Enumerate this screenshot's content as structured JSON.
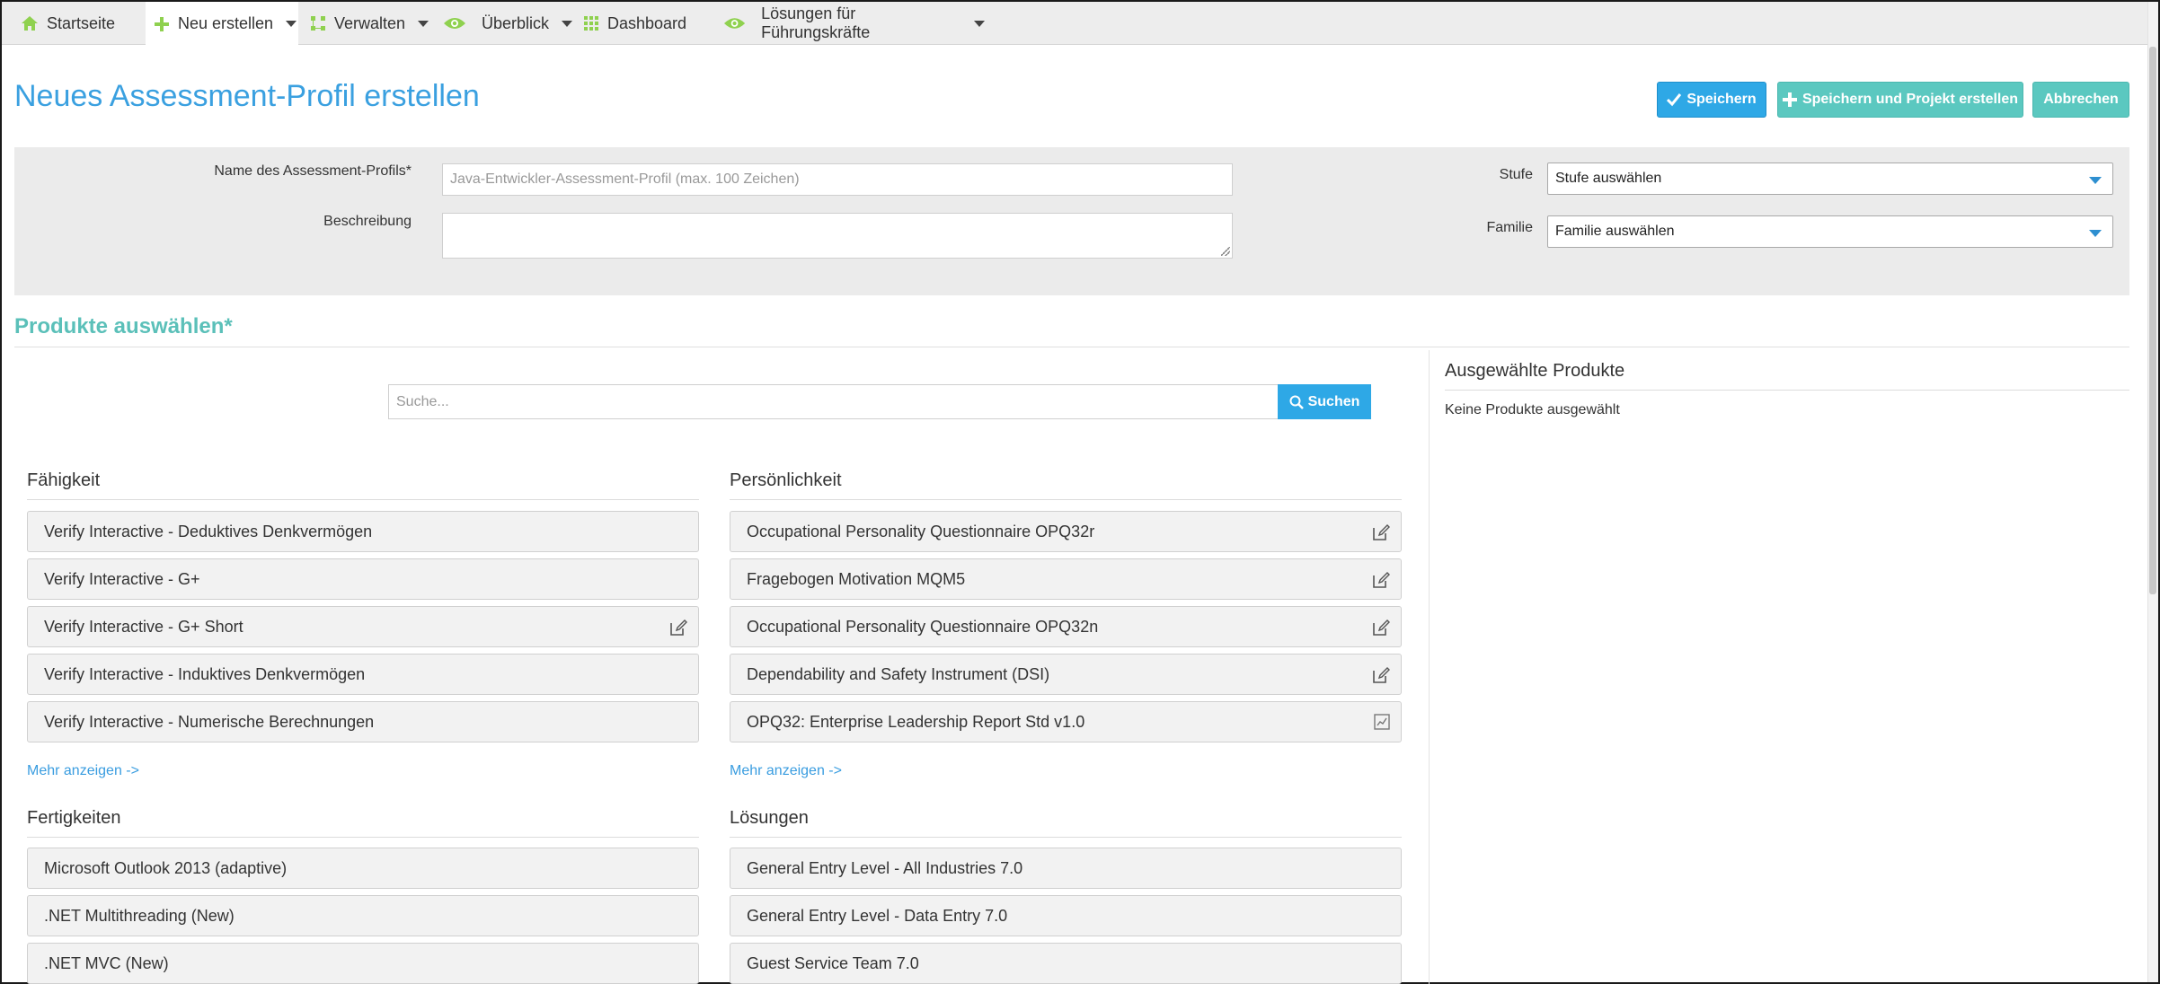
{
  "nav": {
    "items": [
      {
        "label": "Startseite",
        "icon": "home-icon",
        "color": "#8fd14f"
      },
      {
        "label": "Neu erstellen",
        "icon": "plus-icon",
        "color": "#8fd14f"
      },
      {
        "label": "Verwalten",
        "icon": "manage-icon",
        "color": "#8fd14f"
      },
      {
        "label": "Überblick",
        "icon": "eye-icon",
        "color": "#8fd14f"
      },
      {
        "label": "Dashboard",
        "icon": "grid-icon",
        "color": "#8fd14f"
      },
      {
        "label": "Lösungen für Führungskräfte",
        "icon": "eye-icon",
        "color": "#8fd14f"
      }
    ]
  },
  "page": {
    "title": "Neues Assessment-Profil erstellen"
  },
  "actions": {
    "save": "Speichern",
    "save_create_project": "Speichern und Projekt erstellen",
    "cancel": "Abbrechen"
  },
  "form": {
    "name_label": "Name des Assessment-Profils*",
    "name_placeholder": "Java-Entwickler-Assessment-Profil (max. 100 Zeichen)",
    "description_label": "Beschreibung",
    "level_label": "Stufe",
    "level_value": "Stufe auswählen",
    "family_label": "Familie",
    "family_value": "Familie auswählen"
  },
  "products": {
    "section_title": "Produkte auswählen*",
    "search_placeholder": "Suche...",
    "search_button": "Suchen",
    "more_link": "Mehr anzeigen ->",
    "categories": {
      "ability": {
        "title": "Fähigkeit",
        "items": [
          "Verify Interactive - Deduktives Denkvermögen",
          "Verify Interactive - G+",
          "Verify Interactive - G+ Short",
          "Verify Interactive - Induktives Denkvermögen",
          "Verify Interactive - Numerische Berechnungen"
        ]
      },
      "personality": {
        "title": "Persönlichkeit",
        "items": [
          "Occupational Personality Questionnaire OPQ32r",
          "Fragebogen Motivation MQM5",
          "Occupational Personality Questionnaire OPQ32n",
          "Dependability and Safety Instrument (DSI)",
          "OPQ32: Enterprise Leadership Report Std v1.0"
        ]
      },
      "skills": {
        "title": "Fertigkeiten",
        "items": [
          "Microsoft Outlook 2013 (adaptive)",
          ".NET Multithreading (New)",
          ".NET MVC (New)"
        ]
      },
      "solutions": {
        "title": "Lösungen",
        "items": [
          "General Entry Level - All Industries 7.0",
          "General Entry Level - Data Entry 7.0",
          "Guest Service Team 7.0"
        ]
      }
    }
  },
  "selected": {
    "title": "Ausgewählte Produkte",
    "empty_text": "Keine Produkte ausgewählt"
  },
  "colors": {
    "accent_blue": "#2ea8e6",
    "accent_teal": "#5bc8c0",
    "title_blue": "#3aa0e0",
    "nav_icon_green": "#8fd14f"
  }
}
